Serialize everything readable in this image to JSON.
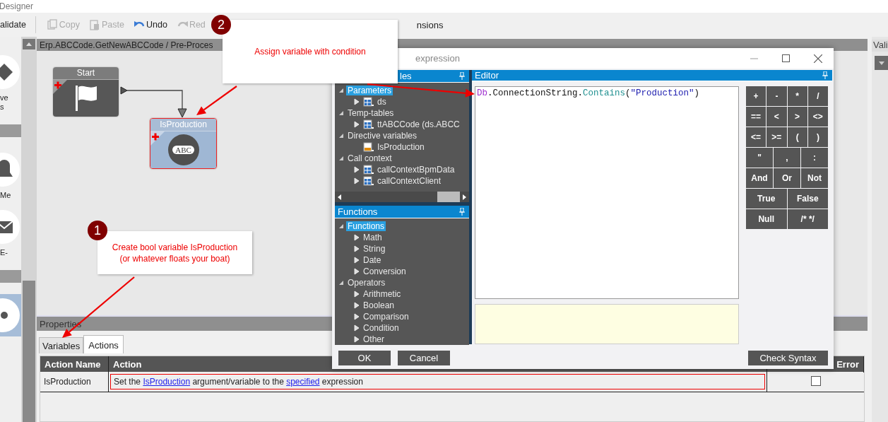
{
  "window": {
    "title": "Designer"
  },
  "toolbar": {
    "items": [
      {
        "label": "alidate",
        "disabled": false
      },
      {
        "label": "Copy",
        "disabled": true
      },
      {
        "label": "Paste",
        "disabled": true
      },
      {
        "label": "Undo",
        "disabled": false
      },
      {
        "label": "Red",
        "disabled": true
      }
    ],
    "trailing": "nsions"
  },
  "toolbox": {
    "items": [
      {
        "kind": "tool",
        "selected": false,
        "lines": [
          "ve",
          "s"
        ]
      },
      {
        "kind": "section"
      },
      {
        "kind": "tool",
        "selected": false,
        "lines": [
          "Me"
        ]
      },
      {
        "kind": "tool",
        "selected": false,
        "lines": [
          "E-"
        ]
      },
      {
        "kind": "section"
      },
      {
        "kind": "tool",
        "selected": true
      }
    ]
  },
  "canvas": {
    "breadcrumb": "Erp.ABCCode.GetNewABCCode / Pre-Proces",
    "nodes": [
      {
        "kind": "start",
        "label": "Start",
        "selected": false
      },
      {
        "kind": "set-variable",
        "label": "IsProduction",
        "badge": "ABC",
        "selected": true
      }
    ]
  },
  "callouts": [
    {
      "number": "2",
      "lines": [
        "Assign variable with condition"
      ]
    },
    {
      "number": "1",
      "lines": [
        "Create bool variable IsProduction",
        "(or whatever floats your boat)"
      ]
    }
  ],
  "dialog": {
    "title": "expression",
    "variables_panel": {
      "title": "les",
      "tree": [
        {
          "label": "Parameters",
          "expanded": true,
          "selected": true,
          "children": [
            {
              "kind": "table",
              "label": "ds",
              "expanded": false,
              "selected": false
            }
          ]
        },
        {
          "label": "Temp-tables",
          "expanded": true,
          "selected": false,
          "children": [
            {
              "kind": "table",
              "label": "ttABCCode (ds.ABCC",
              "expanded": false,
              "selected": false
            }
          ]
        },
        {
          "label": "Directive variables",
          "expanded": true,
          "selected": false,
          "children": [
            {
              "kind": "variable",
              "label": "IsProduction",
              "selected": false
            }
          ]
        },
        {
          "label": "Call context",
          "expanded": true,
          "selected": false,
          "children": [
            {
              "kind": "table",
              "label": "callContextBpmData",
              "expanded": false,
              "selected": false
            },
            {
              "kind": "table",
              "label": "callContextClient",
              "expanded": false,
              "selected": false
            }
          ]
        }
      ]
    },
    "functions_panel": {
      "title": "Functions",
      "tree": [
        {
          "label": "Functions",
          "expanded": true,
          "selected": true,
          "children": [
            {
              "label": "Math",
              "expanded": false,
              "selected": false
            },
            {
              "label": "String",
              "expanded": false,
              "selected": false
            },
            {
              "label": "Date",
              "expanded": false,
              "selected": false
            },
            {
              "label": "Conversion",
              "expanded": false,
              "selected": false
            }
          ]
        },
        {
          "label": "Operators",
          "expanded": true,
          "selected": false,
          "children": [
            {
              "label": "Arithmetic",
              "expanded": false,
              "selected": false
            },
            {
              "label": "Boolean",
              "expanded": false,
              "selected": false
            },
            {
              "label": "Comparison",
              "expanded": false,
              "selected": false
            },
            {
              "label": "Condition",
              "expanded": false,
              "selected": false
            },
            {
              "label": "Other",
              "expanded": false,
              "selected": false
            }
          ]
        }
      ]
    },
    "editor": {
      "title": "Editor",
      "code": [
        {
          "kind": "keyword",
          "text": "Db"
        },
        {
          "kind": "plain",
          "text": ".ConnectionString."
        },
        {
          "kind": "method",
          "text": "Contains"
        },
        {
          "kind": "plain",
          "text": "("
        },
        {
          "kind": "string",
          "text": "\"Production\""
        },
        {
          "kind": "plain",
          "text": ")"
        }
      ]
    },
    "keypad": [
      [
        "+",
        "-",
        "*",
        "/"
      ],
      [
        "==",
        "<",
        ">",
        "<>"
      ],
      [
        "<=",
        ">=",
        "(",
        ")"
      ],
      [
        "\"",
        ",",
        ":"
      ],
      [
        "And",
        "Or",
        "Not"
      ],
      [
        "True",
        "False"
      ],
      [
        "Null",
        "/* */"
      ]
    ],
    "buttons": [
      "OK",
      "Cancel"
    ],
    "check_button": "Check Syntax"
  },
  "properties": {
    "title": "Properties",
    "tabs": [
      {
        "label": "Variables",
        "selected": false
      },
      {
        "label": "Actions",
        "selected": true
      }
    ],
    "table": {
      "columns": [
        "Action Name",
        "Action",
        "Error"
      ],
      "rows": [
        {
          "name": "IsProduction",
          "selected": true,
          "error": false,
          "action": [
            {
              "kind": "text",
              "text": "Set the "
            },
            {
              "kind": "link",
              "text": "IsProduction"
            },
            {
              "kind": "text",
              "text": " argument/variable to the "
            },
            {
              "kind": "link",
              "text": "specified"
            },
            {
              "kind": "text",
              "text": " expression"
            }
          ]
        }
      ]
    }
  },
  "side_panel": {
    "title": "Vali"
  }
}
